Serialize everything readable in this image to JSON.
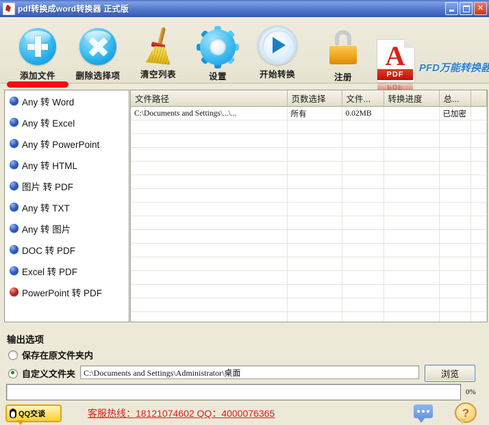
{
  "window": {
    "title": "pdf转换成word转换器  正式版",
    "app_icon": "pdf-app-icon",
    "minimize_label": "最小化",
    "maximize_label": "最大化",
    "close_label": "关闭"
  },
  "toolbar": {
    "items": [
      {
        "label": "添加文件",
        "icon": "add-file-icon"
      },
      {
        "label": "删除选择项",
        "icon": "remove-selected-icon"
      },
      {
        "label": "清空列表",
        "icon": "clear-list-icon"
      },
      {
        "label": "设置",
        "icon": "settings-gear-icon"
      },
      {
        "label": "开始转换",
        "icon": "start-convert-icon"
      },
      {
        "label": "注册",
        "icon": "register-lock-icon"
      }
    ],
    "brand": {
      "logo_label": "PDF",
      "logo_reflection": "PDF",
      "name": "PFD万能转换器"
    }
  },
  "sidebar": {
    "items": [
      {
        "label": "Any 转 Word",
        "bullet": "blue"
      },
      {
        "label": "Any 转 Excel",
        "bullet": "blue"
      },
      {
        "label": "Any 转 PowerPoint",
        "bullet": "blue"
      },
      {
        "label": "Any 转 HTML",
        "bullet": "blue"
      },
      {
        "label": "图片 转 PDF",
        "bullet": "blue"
      },
      {
        "label": "Any 转 TXT",
        "bullet": "blue"
      },
      {
        "label": "Any 转 图片",
        "bullet": "blue"
      },
      {
        "label": "DOC 转 PDF",
        "bullet": "blue"
      },
      {
        "label": "Excel 转 PDF",
        "bullet": "blue"
      },
      {
        "label": "PowerPoint 转 PDF",
        "bullet": "red"
      }
    ]
  },
  "file_table": {
    "columns": [
      "文件路径",
      "页数选择",
      "文件...",
      "转换进度",
      "总..."
    ],
    "rows": [
      {
        "path": "C:\\Documents and Settings\\...\\...",
        "pages": "所有",
        "size": "0.02MB",
        "progress": "",
        "status": "已加密"
      }
    ],
    "empty_row_count": 19
  },
  "output_options": {
    "heading": "输出选项",
    "save_in_source_label": "保存在原文件夹内",
    "save_in_source_selected": false,
    "custom_folder_label": "自定义文件夹",
    "custom_folder_selected": true,
    "custom_folder_path": "C:\\Documents and Settings\\Administrator\\桌面",
    "browse_label": "浏览"
  },
  "progress": {
    "percent_label": "0%",
    "percent_value": 0
  },
  "footer": {
    "qq_badge_label": "QQ交谈",
    "hotline": "客服热线：18121074602 QQ：4000076365",
    "chat_icon": "chat-bubble-icon",
    "help_icon": "help-question-icon"
  },
  "colors": {
    "titlebar": "#4b6fc4",
    "window_bg": "#ece9d8",
    "accent_blue": "#1faae6",
    "alert_red": "#e01a1a",
    "marker_red": "#f40d0d"
  }
}
